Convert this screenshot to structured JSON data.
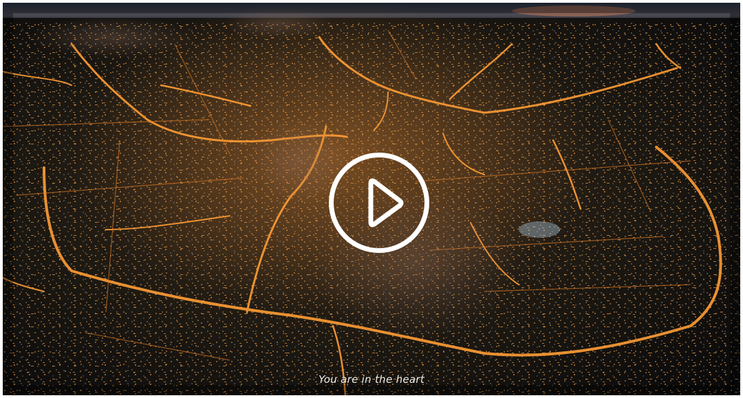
{
  "video": {
    "subtitle": "You are in the heart",
    "play_icon": "play-icon"
  }
}
